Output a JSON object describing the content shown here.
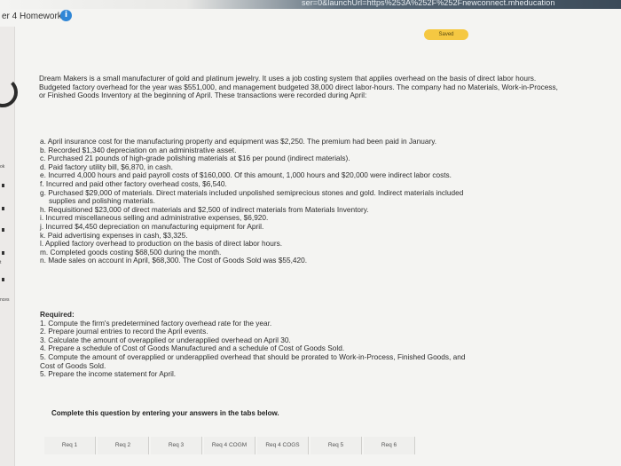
{
  "browser": {
    "url_text": "ser=0&launchUrl=https%253A%252F%252Fnewconnect.mheducation"
  },
  "header": {
    "title": "er 4 Homework",
    "info_icon": "i",
    "saved_label": "Saved"
  },
  "rail": {
    "items": [
      "ok",
      "t",
      "nces"
    ]
  },
  "problem": {
    "intro": "Dream Makers is a small manufacturer of gold and platinum jewelry. It uses a job costing system that applies overhead on the basis of direct labor hours. Budgeted factory overhead for the year was $551,000, and management budgeted 38,000 direct labor-hours. The company had no Materials, Work-in-Process, or Finished Goods Inventory at the beginning of April. These transactions were recorded during April:",
    "transactions": [
      "a. April insurance cost for the manufacturing property and equipment was $2,250. The premium had been paid in January.",
      "b. Recorded $1,340 depreciation on an administrative asset.",
      "c. Purchased 21 pounds of high-grade polishing materials at $16 per pound (indirect materials).",
      "d. Paid factory utility bill, $6,870, in cash.",
      "e. Incurred 4,000 hours and paid payroll costs of $160,000. Of this amount, 1,000 hours and $20,000 were indirect labor costs.",
      "f. Incurred and paid other factory overhead costs, $6,540.",
      "g. Purchased $29,000 of materials. Direct materials included unpolished semiprecious stones and gold. Indirect materials included",
      "supplies and polishing materials.",
      "h. Requisitioned $23,000 of direct materials and $2,500 of indirect materials from Materials Inventory.",
      "i. Incurred miscellaneous selling and administrative expenses, $6,920.",
      "j. Incurred $4,450 depreciation on manufacturing equipment for April.",
      "k. Paid advertising expenses in cash, $3,325.",
      "l. Applied factory overhead to production on the basis of direct labor hours.",
      "m. Completed goods costing $68,500 during the month.",
      "n. Made sales on account in April, $68,300. The Cost of Goods Sold was $55,420."
    ]
  },
  "required": {
    "title": "Required:",
    "items": [
      "1. Compute the firm's predetermined factory overhead rate for the year.",
      "2. Prepare journal entries to record the April events.",
      "3. Calculate the amount of overapplied or underapplied overhead on April 30.",
      "4. Prepare a schedule of Cost of Goods Manufactured and a schedule of Cost of Goods Sold.",
      "5. Compute the amount of overapplied or underapplied overhead that should be prorated to Work-in-Process, Finished Goods, and",
      "Cost of Goods Sold.",
      "5. Prepare the income statement for April."
    ]
  },
  "instruction": "Complete this question by entering your answers in the tabs below.",
  "tabs": [
    "Req 1",
    "Req 2",
    "Req 3",
    "Req 4 COGM",
    "Req 4 COGS",
    "Req 5",
    "Req 6"
  ]
}
